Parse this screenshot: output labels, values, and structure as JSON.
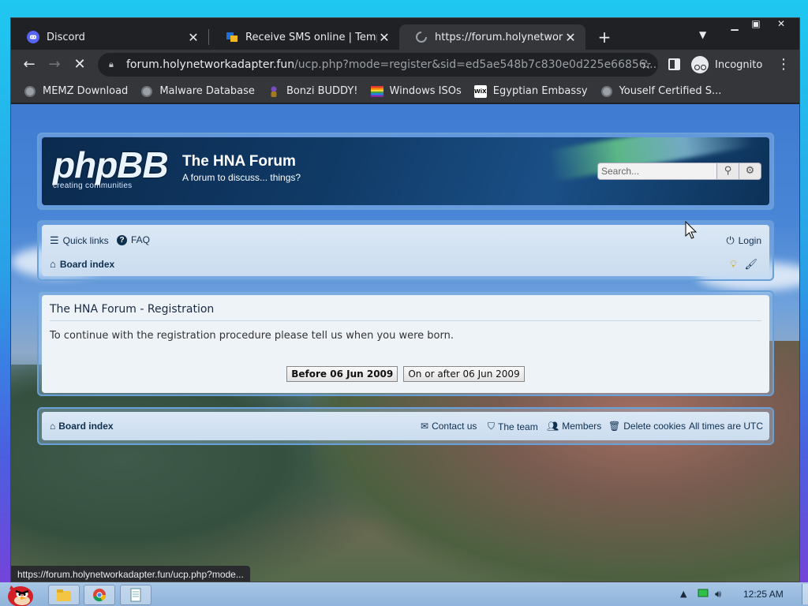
{
  "browser": {
    "tabs": [
      {
        "label": "Discord",
        "icon": "discord-icon"
      },
      {
        "label": "Receive SMS online | Tempora",
        "icon": "sms-site-icon"
      },
      {
        "label": "https://forum.holynetworkada",
        "icon": "loading-spinner-icon"
      }
    ],
    "newtab": "+",
    "address": {
      "host": "forum.holynetworkadapter.fun",
      "path": "/ucp.php?mode=register&sid=ed5ae548b7c830e0d225e66856..."
    },
    "profile": "Incognito",
    "bookmarks": [
      {
        "label": "MEMZ Download",
        "icon": "globe-icon"
      },
      {
        "label": "Malware Database",
        "icon": "globe-icon"
      },
      {
        "label": "Bonzi BUDDY!",
        "icon": "bonzi-icon"
      },
      {
        "label": "Windows ISOs",
        "icon": "rainbow-icon"
      },
      {
        "label": "Egyptian Embassy",
        "icon": "wix-icon"
      },
      {
        "label": "Youself Certified S...",
        "icon": "globe-icon"
      }
    ],
    "status_url": "https://forum.holynetworkadapter.fun/ucp.php?mode..."
  },
  "forum": {
    "logo_main": "phpBB",
    "logo_sub": "creating communities",
    "site_name": "The HNA Forum",
    "site_desc": "A forum to discuss... things?",
    "search_placeholder": "Search...",
    "nav": {
      "quick_links": "Quick links",
      "faq": "FAQ",
      "login": "Login",
      "board_index": "Board index"
    },
    "registration": {
      "title": "The HNA Forum - Registration",
      "text": "To continue with the registration procedure please tell us when you were born.",
      "btn_before": "Before 06 Jun 2009",
      "btn_after": "On or after 06 Jun 2009"
    },
    "footer": {
      "board_index": "Board index",
      "contact": "Contact us",
      "team": "The team",
      "members": "Members",
      "delete_cookies": "Delete cookies",
      "timezone": "All times are UTC"
    }
  },
  "taskbar": {
    "clock": "12:25 AM"
  }
}
